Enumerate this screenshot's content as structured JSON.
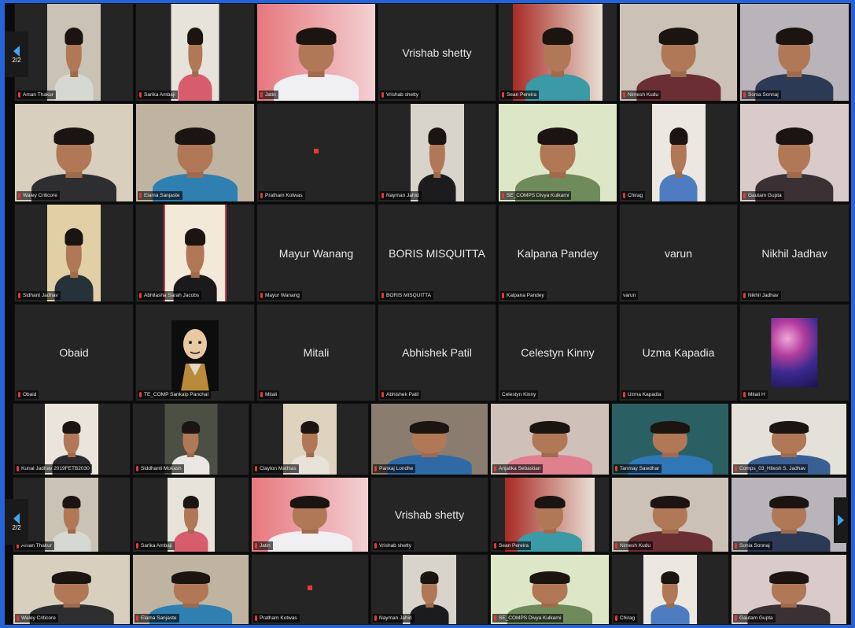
{
  "navigation": {
    "prev_page_top": "2/2",
    "prev_page_bottom": "2/2",
    "next_page_bottom": ""
  },
  "rows": [
    {
      "tiles": [
        {
          "label": "Aman Thakur",
          "video": {
            "wall": "#c9c2b5",
            "shirt": "#d6d9d2",
            "w": 0.45
          }
        },
        {
          "label": "Sarika Ambaji",
          "video": {
            "wall": "#e7e2da",
            "shirt": "#d75d6c",
            "w": 0.4
          }
        },
        {
          "label": "Jatin",
          "video": {
            "wall": "#e7787e",
            "shirt": "#f0f0f3",
            "w": 1.0,
            "grad": "#f2d0d3"
          }
        },
        {
          "label": "Vrishab shetty",
          "name": "Vrishab shetty"
        },
        {
          "label": "Sean Pereira",
          "video": {
            "wall": "#a82b25",
            "shirt": "#3b9aa6",
            "w": 0.75,
            "grad": "#e9e0d6"
          }
        },
        {
          "label": "Nimesh Kudu",
          "video": {
            "wall": "#cbc1b6",
            "shirt": "#6b2f33",
            "w": 1.0
          }
        },
        {
          "label": "Sonia Sonnaj",
          "video": {
            "wall": "#b9b4b9",
            "shirt": "#2c3a55",
            "w": 1.0
          }
        }
      ]
    },
    {
      "tiles": [
        {
          "label": "Waley Criticore",
          "video": {
            "wall": "#d9cfbf",
            "shirt": "#2e2e30",
            "w": 1.0
          }
        },
        {
          "label": "Elama Sanjaste",
          "video": {
            "wall": "#bfb3a2",
            "shirt": "#2f7fb0",
            "w": 1.0
          }
        },
        {
          "label": "Pratham Kotwas",
          "dot": true
        },
        {
          "label": "Nayman Jahid",
          "video": {
            "wall": "#d8d4cc",
            "shirt": "#1c1c1e",
            "w": 0.45
          }
        },
        {
          "label": "SE_COMPS Divya Kulkarni",
          "video": {
            "wall": "#dde7c7",
            "shirt": "#6f8a5b",
            "w": 1.0
          }
        },
        {
          "label": "Chirag",
          "video": {
            "wall": "#ece8e1",
            "shirt": "#4d7dc0",
            "w": 0.45
          }
        },
        {
          "label": "Gautam Gupta",
          "video": {
            "wall": "#d8cbc9",
            "shirt": "#3b3033",
            "w": 1.0
          }
        }
      ]
    },
    {
      "tiles": [
        {
          "label": "Sidhant Jadhav",
          "video": {
            "wall": "#e1cfa5",
            "shirt": "#26323a",
            "w": 0.45
          }
        },
        {
          "label": "Abhilasha Sarah Jacobs",
          "video": {
            "wall": "#f3e9d9",
            "shirt": "#1a1a1d",
            "w": 0.5,
            "border": "#c93e55"
          }
        },
        {
          "label": "Mayur Wanang",
          "name": "Mayur Wanang"
        },
        {
          "label": "BORIS MISQUITTA",
          "name": "BORIS MISQUITTA"
        },
        {
          "label": "Kalpana Pandey",
          "name": "Kalpana Pandey"
        },
        {
          "label": "varun",
          "name": "varun",
          "mic": false
        },
        {
          "label": "Nikhil Jadhav",
          "name": "Nikhil Jadhav"
        }
      ]
    },
    {
      "tiles": [
        {
          "label": "Obaid",
          "name": "Obaid"
        },
        {
          "label": "TE_COMP Sankalp Panchal",
          "avatar": true
        },
        {
          "label": "Mitali",
          "name": "Mitali"
        },
        {
          "label": "Abhishek Patil",
          "name": "Abhishek Patil"
        },
        {
          "label": "Celestyn Kinny",
          "name": "Celestyn Kinny",
          "mic": false
        },
        {
          "label": "Uzma Kapadia",
          "name": "Uzma Kapadia"
        },
        {
          "label": "Mitali H",
          "art": true
        }
      ]
    },
    {
      "tiles": [
        {
          "label": "Kunal Jadhav 2019FETB2030",
          "video": {
            "wall": "#eae4dc",
            "shirt": "#2b2b2f",
            "w": 0.45
          }
        },
        {
          "label": "Siddhanti Mokash",
          "video": {
            "wall": "#4b4f44",
            "shirt": "#e9e6e3",
            "w": 0.45
          }
        },
        {
          "label": "Clayton Mathias",
          "video": {
            "wall": "#ded3bf",
            "shirt": "#e8e2d8",
            "w": 0.45
          }
        },
        {
          "label": "Pankaj Londhe",
          "video": {
            "wall": "#8b7c70",
            "shirt": "#2f6aa6",
            "w": 1.0
          }
        },
        {
          "label": "Anjalika Sebastian",
          "video": {
            "wall": "#cfc1ba",
            "shirt": "#e07f8e",
            "w": 1.0
          }
        },
        {
          "label": "Tanmay Sawdhar",
          "video": {
            "wall": "#2a5f63",
            "shirt": "#3077b8",
            "w": 1.0
          }
        },
        {
          "label": "Comps_03_Hitesh S. Jadhav",
          "video": {
            "wall": "#e4e1da",
            "shirt": "#3a5f92",
            "w": 1.0
          }
        }
      ]
    },
    {
      "tiles": [
        {
          "label": "Aman Thakur",
          "video": {
            "wall": "#c9c2b5",
            "shirt": "#d6d9d2",
            "w": 0.45
          }
        },
        {
          "label": "Sarika Ambaji",
          "video": {
            "wall": "#e7e2da",
            "shirt": "#d75d6c",
            "w": 0.4
          }
        },
        {
          "label": "Jatin",
          "video": {
            "wall": "#e7787e",
            "shirt": "#f0f0f3",
            "w": 1.0,
            "grad": "#f2d0d3"
          }
        },
        {
          "label": "Vrishab shetty",
          "name": "Vrishab shetty"
        },
        {
          "label": "Sean Pereira",
          "video": {
            "wall": "#a82b25",
            "shirt": "#3b9aa6",
            "w": 0.75,
            "grad": "#e9e0d6"
          }
        },
        {
          "label": "Nimesh Kudu",
          "video": {
            "wall": "#cbc1b6",
            "shirt": "#6b2f33",
            "w": 1.0
          }
        },
        {
          "label": "Sonia Sonnaj",
          "video": {
            "wall": "#b9b4b9",
            "shirt": "#2c3a55",
            "w": 1.0
          }
        }
      ]
    },
    {
      "tiles": [
        {
          "label": "Waley Criticore",
          "video": {
            "wall": "#d9cfbf",
            "shirt": "#2e2e30",
            "w": 1.0
          }
        },
        {
          "label": "Elama Sanjaste",
          "video": {
            "wall": "#bfb3a2",
            "shirt": "#2f7fb0",
            "w": 1.0
          }
        },
        {
          "label": "Pratham Kotwas",
          "dot": true
        },
        {
          "label": "Nayman Jahid",
          "video": {
            "wall": "#d8d4cc",
            "shirt": "#1c1c1e",
            "w": 0.45
          }
        },
        {
          "label": "SE_COMPS Divya Kulkarni",
          "video": {
            "wall": "#dde7c7",
            "shirt": "#6f8a5b",
            "w": 1.0
          }
        },
        {
          "label": "Chirag",
          "video": {
            "wall": "#ece8e1",
            "shirt": "#4d7dc0",
            "w": 0.45
          }
        },
        {
          "label": "Gautam Gupta",
          "video": {
            "wall": "#d8cbc9",
            "shirt": "#3b3033",
            "w": 1.0
          }
        }
      ]
    }
  ]
}
